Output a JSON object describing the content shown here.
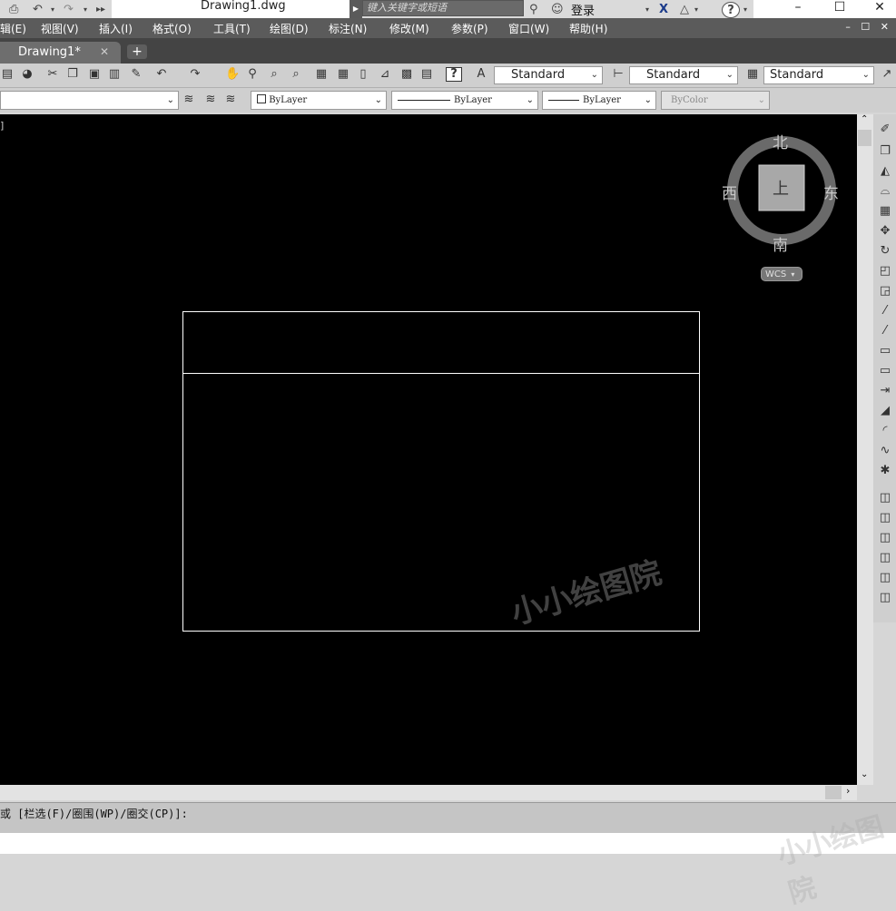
{
  "titlebar": {
    "document_title": "Drawing1.dwg",
    "search_placeholder": "键入关键字或短语",
    "login_label": "登录",
    "window_minimize": "–",
    "window_maximize": "☐",
    "window_close": "✕"
  },
  "menubar": {
    "items": [
      {
        "label": "辑(E)"
      },
      {
        "label": "视图(V)"
      },
      {
        "label": "插入(I)"
      },
      {
        "label": "格式(O)"
      },
      {
        "label": "工具(T)"
      },
      {
        "label": "绘图(D)"
      },
      {
        "label": "标注(N)"
      },
      {
        "label": "修改(M)"
      },
      {
        "label": "参数(P)"
      },
      {
        "label": "窗口(W)"
      },
      {
        "label": "帮助(H)"
      }
    ],
    "mdi_controls": "–  ☐  ✕"
  },
  "tabs": {
    "active_label": "Drawing1*",
    "close_glyph": "✕",
    "add_glyph": "+"
  },
  "toolbar_styles": {
    "text_style": "Standard",
    "dim_style": "Standard",
    "table_style": "Standard"
  },
  "properties_bar": {
    "layer_value": "",
    "color": "ByLayer",
    "linetype": "ByLayer",
    "lineweight": "ByLayer",
    "plot_style": "ByColor"
  },
  "viewcube": {
    "north": "北",
    "south": "南",
    "east": "东",
    "west": "西",
    "face": "上",
    "ucs_label": "WCS"
  },
  "command_line": {
    "prompt": "或 [栏选(F)/圈围(WP)/圈交(CP)]:"
  },
  "watermark": {
    "text": "小小绘图院"
  },
  "colors": {
    "canvas_background": "#000000",
    "geometry_stroke": "#ffffff",
    "menubar_background": "#5b5b5b"
  }
}
